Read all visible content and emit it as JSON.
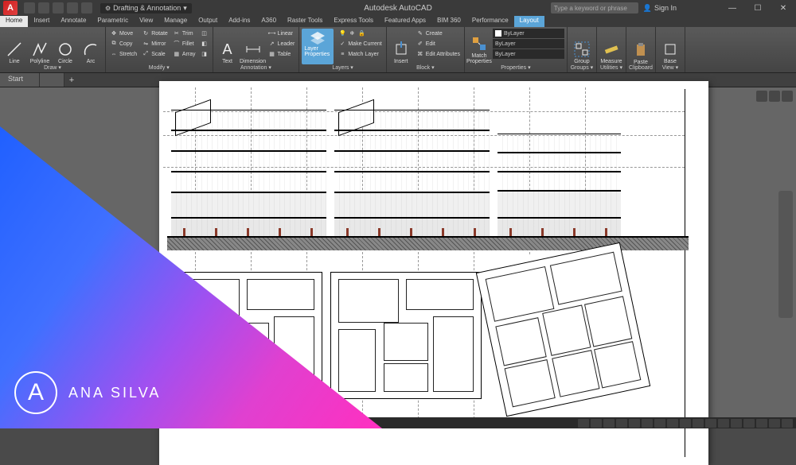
{
  "app": {
    "title": "Autodesk AutoCAD",
    "logo_letter": "A"
  },
  "qat": {
    "workspace": "Drafting & Annotation"
  },
  "search": {
    "placeholder": "Type a keyword or phrase",
    "signin": "Sign In"
  },
  "window_controls": {
    "min": "—",
    "max": "☐",
    "close": "✕"
  },
  "tabs": [
    "Home",
    "Insert",
    "Annotate",
    "Parametric",
    "View",
    "Manage",
    "Output",
    "Add-ins",
    "A360",
    "Raster Tools",
    "Express Tools",
    "Featured Apps",
    "BIM 360",
    "Performance",
    "Layout"
  ],
  "active_tab_index": 0,
  "selected_tab_index": 14,
  "ribbon": {
    "draw": {
      "label": "Draw ▾",
      "line": "Line",
      "polyline": "Polyline",
      "circle": "Circle",
      "arc": "Arc"
    },
    "modify": {
      "label": "Modify ▾",
      "move": "Move",
      "copy": "Copy",
      "stretch": "Stretch",
      "rotate": "Rotate",
      "mirror": "Mirror",
      "scale": "Scale",
      "trim": "Trim",
      "fillet": "Fillet",
      "array": "Array"
    },
    "annotation": {
      "label": "Annotation ▾",
      "text": "Text",
      "dimension": "Dimension",
      "linear": "Linear",
      "leader": "Leader",
      "table": "Table"
    },
    "layers": {
      "label": "Layers ▾",
      "layer_props": "Layer Properties",
      "make_current": "Make Current",
      "match_layer": "Match Layer"
    },
    "block": {
      "label": "Block ▾",
      "insert": "Insert",
      "create": "Create",
      "edit": "Edit",
      "edit_attributes": "Edit Attributes"
    },
    "properties": {
      "label": "Properties ▾",
      "match": "Match Properties",
      "bylayer": "ByLayer",
      "bylayer2": "ByLayer",
      "bylayer3": "ByLayer"
    },
    "groups": {
      "label": "Groups ▾",
      "group": "Group"
    },
    "utilities": {
      "label": "Utilities ▾",
      "measure": "Measure"
    },
    "clipboard": {
      "label": "Clipboard",
      "paste": "Paste"
    },
    "view": {
      "label": "View ▾",
      "base": "Base"
    }
  },
  "filetabs": {
    "current": "Start",
    "add": "+"
  },
  "watermark": {
    "name": "ANA SILVA",
    "initial": "A"
  }
}
